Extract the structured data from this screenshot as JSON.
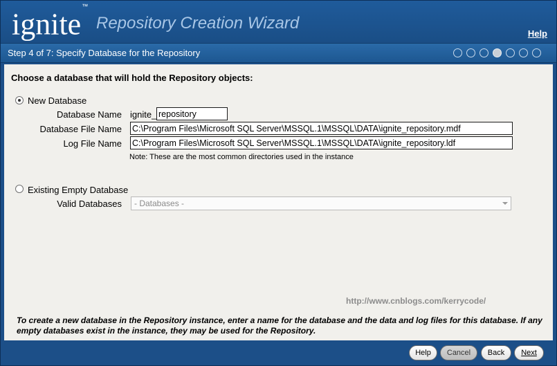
{
  "header": {
    "logo_text": "ignite",
    "logo_tm": "™",
    "title": "Repository Creation Wizard",
    "help_link": "Help"
  },
  "stepbar": {
    "label": "Step 4 of 7:  Specify Database for the Repository",
    "total_steps": 7,
    "current_step": 4
  },
  "content": {
    "heading": "Choose a database that will hold the Repository objects:",
    "new_db": {
      "radio_label": "New Database",
      "selected": true,
      "db_name_label": "Database Name",
      "db_name_prefix": "ignite_",
      "db_name_value": "repository",
      "db_file_label": "Database File Name",
      "db_file_value": "C:\\Program Files\\Microsoft SQL Server\\MSSQL.1\\MSSQL\\DATA\\ignite_repository.mdf",
      "log_file_label": "Log File Name",
      "log_file_value": "C:\\Program Files\\Microsoft SQL Server\\MSSQL.1\\MSSQL\\DATA\\ignite_repository.ldf",
      "note": "Note: These are the most common directories used in the instance"
    },
    "existing_db": {
      "radio_label": "Existing Empty Database",
      "selected": false,
      "valid_label": "Valid Databases",
      "select_value": "- Databases -"
    },
    "watermark": "http://www.cnblogs.com/kerrycode/",
    "info": "To create a new database in the Repository instance, enter a name for the database and the data and log files for this database. If any empty databases exist in the instance, they may be used for the Repository."
  },
  "footer": {
    "help": "Help",
    "cancel": "Cancel",
    "back": "Back",
    "next": "Next"
  }
}
